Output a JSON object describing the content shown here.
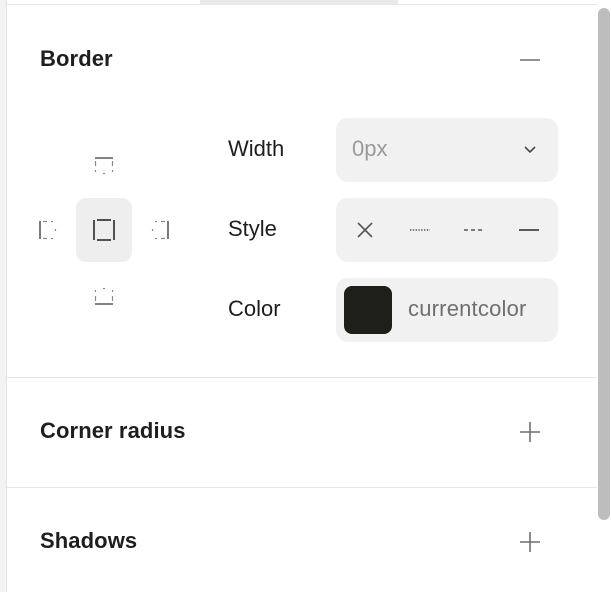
{
  "sections": {
    "border": {
      "title": "Border",
      "toggle_icon": "minus-icon"
    },
    "corner_radius": {
      "title": "Corner radius",
      "toggle_icon": "plus-icon"
    },
    "shadows": {
      "title": "Shadows",
      "toggle_icon": "plus-icon"
    }
  },
  "border_sides": {
    "options": [
      "top",
      "left",
      "all",
      "right",
      "bottom"
    ],
    "selected": "all"
  },
  "border_fields": {
    "width": {
      "label": "Width",
      "value": "0px"
    },
    "style": {
      "label": "Style",
      "options": [
        "none",
        "dotted",
        "dashed",
        "solid"
      ],
      "option_icons": [
        "x-icon",
        "dotted-line-icon",
        "dashed-line-icon",
        "solid-line-icon"
      ]
    },
    "color": {
      "label": "Color",
      "swatch": "#1e1e1a",
      "value": "currentcolor"
    }
  },
  "colors": {
    "text": "#1e1e1e",
    "field_bg": "#f1f1f1",
    "active_bg": "#eeeeee",
    "muted_text": "#9a9a9a"
  }
}
